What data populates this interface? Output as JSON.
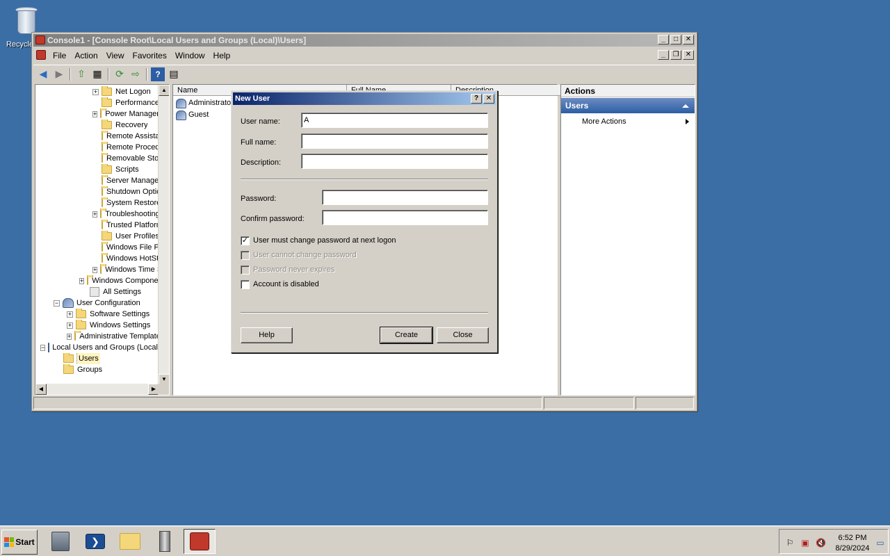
{
  "desktop": {
    "recycle_bin_label": "Recycle Bin"
  },
  "window": {
    "title": "Console1 - [Console Root\\Local Users and Groups (Local)\\Users]",
    "menu": [
      "File",
      "Action",
      "View",
      "Favorites",
      "Window",
      "Help"
    ]
  },
  "tree": {
    "items": [
      "Net Logon",
      "Performance",
      "Power Management",
      "Recovery",
      "Remote Assistance",
      "Remote Procedure Call",
      "Removable Storage Access",
      "Scripts",
      "Server Manager",
      "Shutdown Options",
      "System Restore",
      "Troubleshooting",
      "Trusted Platform Module Services",
      "User Profiles",
      "Windows File Protection",
      "Windows HotStart",
      "Windows Time Service",
      "Windows Components",
      "All Settings",
      "User Configuration",
      "Software Settings",
      "Windows Settings",
      "Administrative Templates",
      "Local Users and Groups (Local)",
      "Users",
      "Groups"
    ]
  },
  "list": {
    "columns": [
      "Name",
      "Full Name",
      "Description"
    ],
    "rows": [
      "Administrator",
      "Guest"
    ]
  },
  "actions": {
    "title": "Actions",
    "section": "Users",
    "item": "More Actions"
  },
  "dialog": {
    "title": "New User",
    "username_label": "User name:",
    "username_value": "A",
    "fullname_label": "Full name:",
    "fullname_value": "",
    "description_label": "Description:",
    "description_value": "",
    "password_label": "Password:",
    "confirm_label": "Confirm password:",
    "cb_must_change": "User must change password at next logon",
    "cb_cannot_change": "User cannot change password",
    "cb_never_expires": "Password never expires",
    "cb_disabled": "Account is disabled",
    "must_change_checked": true,
    "help_button": "Help",
    "create_button": "Create",
    "close_button": "Close"
  },
  "taskbar": {
    "start_label": "Start",
    "time": "6:52 PM",
    "date": "8/29/2024"
  }
}
